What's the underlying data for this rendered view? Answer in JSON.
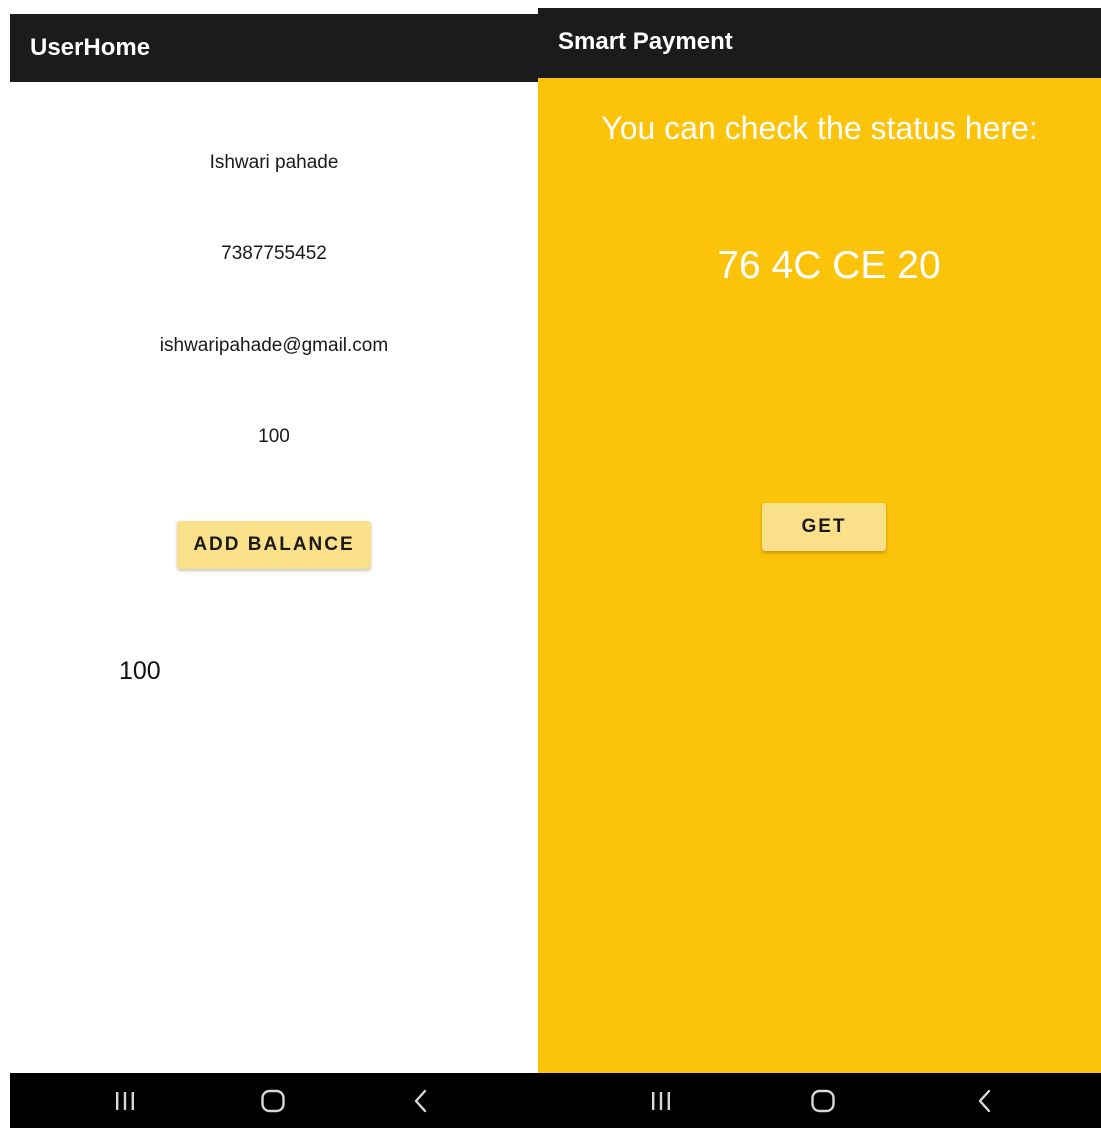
{
  "left_screen": {
    "app_title": "UserHome",
    "user_name": "Ishwari pahade",
    "phone": "7387755452",
    "email": "ishwaripahade@gmail.com",
    "balance": "100",
    "add_balance_label": "ADD BALANCE",
    "balance_result": "100"
  },
  "right_screen": {
    "app_title": "Smart Payment",
    "status_heading": "You can check the status here:",
    "tag_id": "76 4C CE 20",
    "get_label": "GET"
  },
  "navigation": {
    "icons": [
      "recent-apps-icon",
      "home-icon",
      "back-icon"
    ]
  },
  "colors": {
    "app_bar": "#1b1b1b",
    "accent_yellow": "#fcc30b",
    "button_fill": "#fbe08a",
    "nav_bar": "#000000"
  }
}
